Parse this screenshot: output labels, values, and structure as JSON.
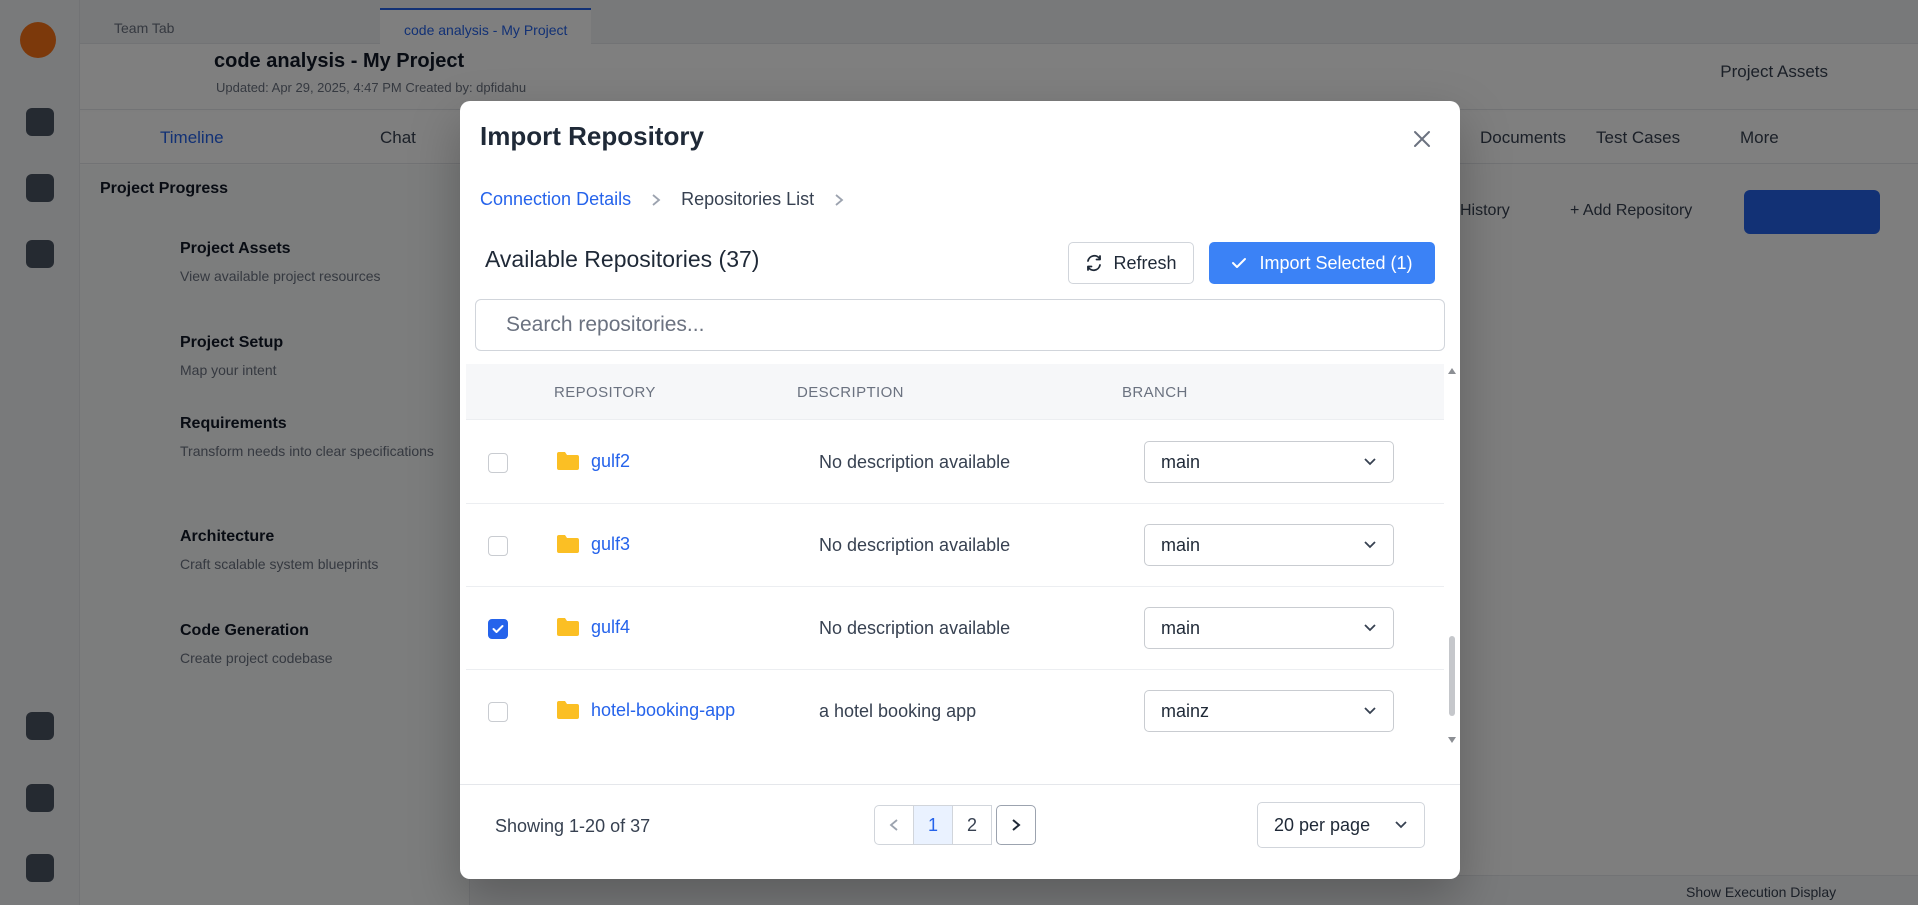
{
  "background": {
    "tabs": [
      "Team Tab",
      "code analysis - My Project"
    ],
    "project_title": "code analysis - My Project",
    "project_meta": "Updated: Apr 29, 2025, 4:47 PM   Created by: dpfidahu",
    "header_right": "Project Assets",
    "nav_items": [
      "Timeline",
      "Chat",
      "Documents",
      "Test Cases",
      "More"
    ],
    "left_panel_title": "Project Progress",
    "steps": [
      {
        "title": "Project Assets",
        "sub": "View available project resources"
      },
      {
        "title": "Project Setup",
        "sub": "Map your intent"
      },
      {
        "title": "Requirements",
        "sub": "Transform needs into clear specifications"
      },
      {
        "title": "Architecture",
        "sub": "Craft scalable system blueprints"
      },
      {
        "title": "Code Generation",
        "sub": "Create project codebase"
      }
    ],
    "right_actions": [
      "History",
      "+ Add Repository"
    ],
    "footer_text": "Show Execution Display"
  },
  "modal": {
    "title": "Import Repository",
    "breadcrumb": [
      "Connection Details",
      "Repositories List"
    ],
    "available_title": "Available Repositories (37)",
    "refresh_label": "Refresh",
    "import_label": "Import Selected (1)",
    "search_placeholder": "Search repositories...",
    "columns": [
      "REPOSITORY",
      "DESCRIPTION",
      "BRANCH"
    ],
    "rows": [
      {
        "name": "gulf2",
        "description": "No description available",
        "branch": "main",
        "checked": false
      },
      {
        "name": "gulf3",
        "description": "No description available",
        "branch": "main",
        "checked": false
      },
      {
        "name": "gulf4",
        "description": "No description available",
        "branch": "main",
        "checked": true
      },
      {
        "name": "hotel-booking-app",
        "description": "a hotel booking app",
        "branch": "mainz",
        "checked": false
      }
    ],
    "showing": "Showing 1-20 of 37",
    "pages": [
      "1",
      "2"
    ],
    "current_page": "1",
    "per_page": "20 per page"
  },
  "colors": {
    "accent": "#2563eb",
    "import_button": "#3b82f6",
    "folder": "#fbbf24"
  },
  "icons": [
    "close-icon",
    "chevron-right-icon",
    "refresh-icon",
    "check-icon",
    "folder-icon",
    "chevron-down-icon",
    "chevron-left-icon"
  ]
}
